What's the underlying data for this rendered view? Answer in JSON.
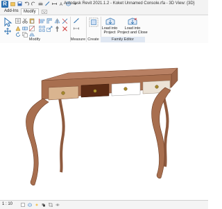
{
  "window": {
    "title": "Autodesk Revit 2021.1.2 - Koket Unnamed Console.rfa - 3D View: {3D}"
  },
  "app_logo": "R",
  "tabs": [
    {
      "label": "Add-Ins",
      "active": false
    },
    {
      "label": "Modify",
      "active": true
    }
  ],
  "ribbon": {
    "panels": {
      "modify": "Modify",
      "measure": "Measure",
      "create": "Create",
      "family_editor": "Family Editor"
    },
    "buttons": {
      "load_into_project": "Load into\nProject",
      "load_into_project_close": "Load into\nProject and Close"
    }
  },
  "status": {
    "scale": "1 : 10"
  },
  "colors": {
    "drawer_light": "#d9b48f",
    "drawer_dark": "#5a2a14",
    "drawer_white": "#ffffff",
    "drawer_cream": "#ece3d6",
    "wood": "#a86f4f",
    "accent": "#2a6fb0",
    "family_editor_panel": "#dfe7f2"
  }
}
